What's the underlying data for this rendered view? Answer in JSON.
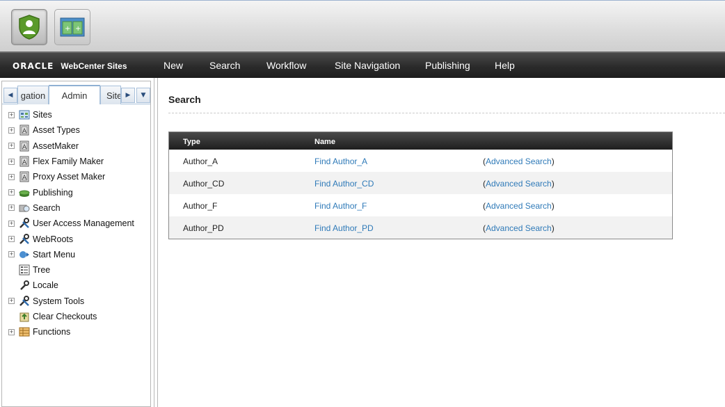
{
  "brand": {
    "oracle": "ORACLE",
    "product": "WebCenter Sites"
  },
  "menu": [
    "New",
    "Search",
    "Workflow",
    "Site Navigation",
    "Publishing",
    "Help"
  ],
  "tabs": {
    "left": "gation",
    "active": "Admin",
    "right": "Site"
  },
  "tree": [
    {
      "label": "Sites",
      "icon": "sites-icon",
      "expand": true
    },
    {
      "label": "Asset Types",
      "icon": "asset-icon",
      "expand": true
    },
    {
      "label": "AssetMaker",
      "icon": "asset-icon",
      "expand": true
    },
    {
      "label": "Flex Family Maker",
      "icon": "asset-icon",
      "expand": true
    },
    {
      "label": "Proxy Asset Maker",
      "icon": "asset-icon",
      "expand": true
    },
    {
      "label": "Publishing",
      "icon": "publishing-icon",
      "expand": true
    },
    {
      "label": "Search",
      "icon": "search-icon",
      "expand": true
    },
    {
      "label": "User Access Management",
      "icon": "tools-icon",
      "expand": true
    },
    {
      "label": "WebRoots",
      "icon": "tools-icon",
      "expand": true
    },
    {
      "label": "Start Menu",
      "icon": "start-menu-icon",
      "expand": true
    },
    {
      "label": "Tree",
      "icon": "tree-icon",
      "expand": false
    },
    {
      "label": "Locale",
      "icon": "wrench-icon",
      "expand": false
    },
    {
      "label": "System Tools",
      "icon": "tools-icon",
      "expand": true
    },
    {
      "label": "Clear Checkouts",
      "icon": "checkout-icon",
      "expand": false
    },
    {
      "label": "Functions",
      "icon": "functions-icon",
      "expand": true
    }
  ],
  "page": {
    "title": "Search"
  },
  "results": {
    "headers": {
      "type": "Type",
      "name": "Name"
    },
    "rows": [
      {
        "type": "Author_A",
        "name": "Find Author_A",
        "advanced": "Advanced Search"
      },
      {
        "type": "Author_CD",
        "name": "Find Author_CD",
        "advanced": "Advanced Search"
      },
      {
        "type": "Author_F",
        "name": "Find Author_F",
        "advanced": "Advanced Search"
      },
      {
        "type": "Author_PD",
        "name": "Find Author_PD",
        "advanced": "Advanced Search"
      }
    ]
  },
  "colors": {
    "link": "#2f7ab8",
    "nav_bg": "#2b2b2b"
  }
}
